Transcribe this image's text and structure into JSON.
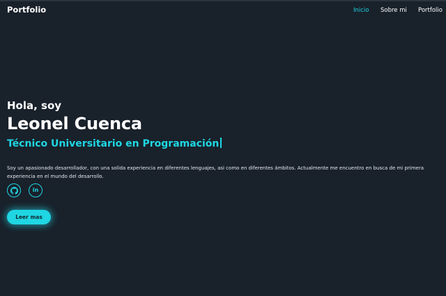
{
  "header": {
    "brand": "Portfolio",
    "nav": [
      {
        "label": "Inicio",
        "active": true
      },
      {
        "label": "Sobre mi",
        "active": false
      },
      {
        "label": "Portfolio",
        "active": false
      }
    ]
  },
  "hero": {
    "greeting": "Hola, soy",
    "name": "Leonel Cuenca",
    "role": "Técnico Universitario en Programación",
    "description": "Soy un apasionado desarrollador, con una solida experiencia en diferentes lenguajes, asi como en diferentes ámbitos. Actualmente me encuentro en busca de mi primera experiencia en el mundo del desarrollo.",
    "social": [
      {
        "icon": "github-icon"
      },
      {
        "icon": "linkedin-icon",
        "glyph": "in"
      }
    ],
    "cta_label": "Leer mas"
  },
  "colors": {
    "background": "#19212b",
    "accent": "#1fd6e2",
    "text": "#ffffff"
  }
}
